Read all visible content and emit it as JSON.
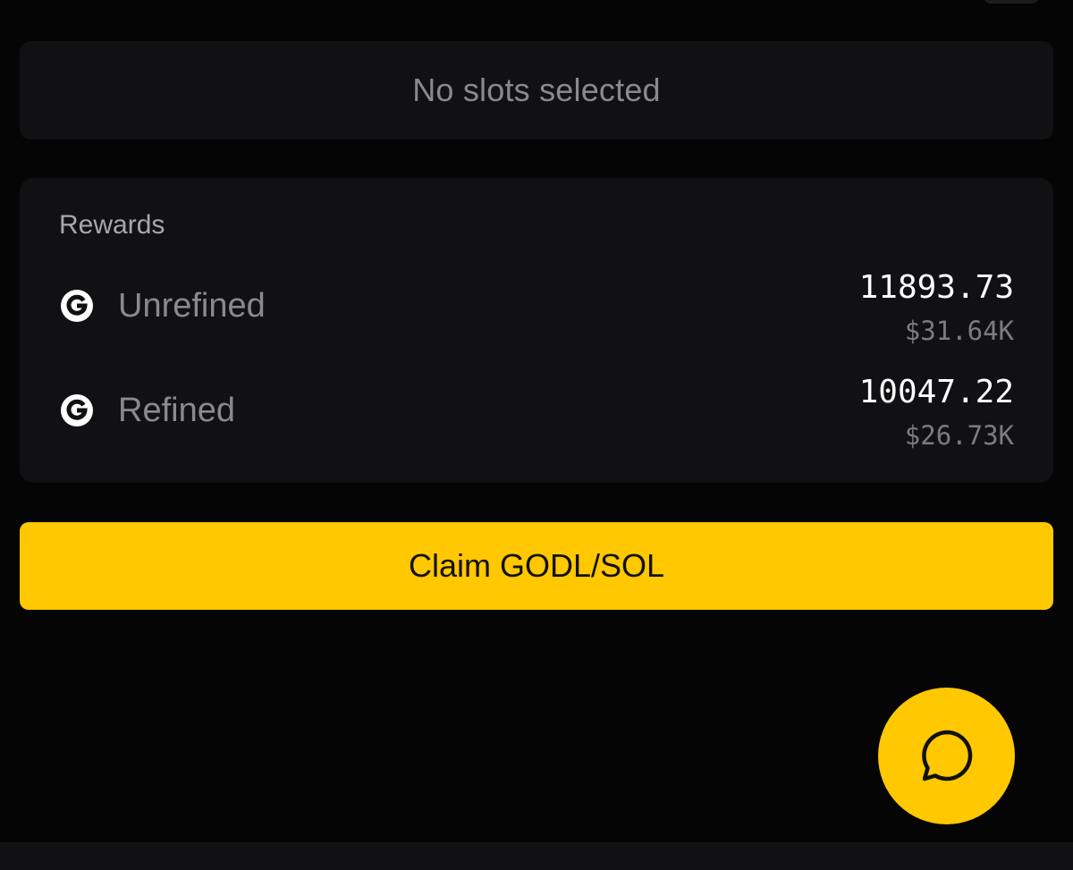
{
  "slots": {
    "empty_message": "No slots selected"
  },
  "rewards": {
    "title": "Rewards",
    "items": [
      {
        "label": "Unrefined",
        "amount": "11893.73",
        "usd": "$31.64K",
        "icon": "godl-token-icon"
      },
      {
        "label": "Refined",
        "amount": "10047.22",
        "usd": "$26.73K",
        "icon": "godl-token-icon"
      }
    ]
  },
  "claim": {
    "label": "Claim GODL/SOL"
  },
  "chat": {
    "icon": "chat-bubble-icon"
  },
  "colors": {
    "background": "#050505",
    "card": "#111113",
    "accent": "#ffc800",
    "muted_text": "#8a8a8e"
  }
}
